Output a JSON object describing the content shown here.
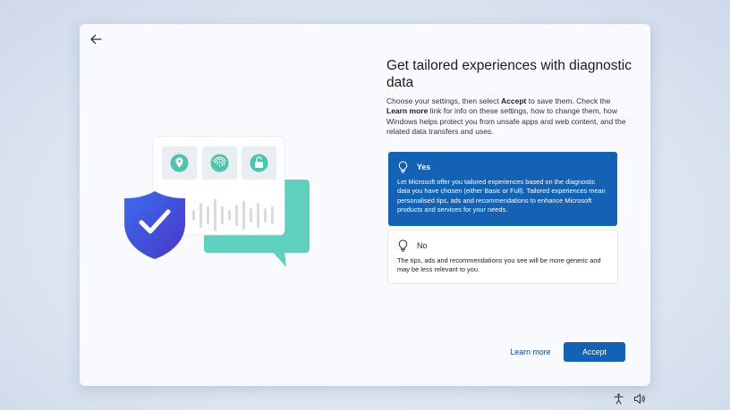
{
  "window": {
    "back_icon": "arrow-left-icon"
  },
  "heading": {
    "title": "Get tailored experiences with diagnostic data",
    "desc_1": "Choose your settings, then select ",
    "desc_accept": "Accept",
    "desc_2": " to save them. Check the ",
    "desc_learn": "Learn more",
    "desc_3": " link for info on these settings, how to change them, how Windows helps protect you from unsafe apps and web content, and the related data transfers and uses."
  },
  "options": [
    {
      "label": "Yes",
      "selected": true,
      "icon": "lightbulb-icon",
      "text": "Let Microsoft offer you tailored experiences based on the diagnostic data you have chosen (either Basic or Full). Tailored experiences mean personalised tips, ads and recommendations to enhance Microsoft products and services for your needs."
    },
    {
      "label": "No",
      "selected": false,
      "icon": "lightbulb-icon",
      "text": "The tips, ads and recommendations you see will be more generic and may be less relevant to you."
    }
  ],
  "footer": {
    "learn_more": "Learn more",
    "accept": "Accept"
  },
  "tray": [
    "accessibility-icon",
    "volume-icon"
  ],
  "colors": {
    "accent": "#1462b6",
    "teal": "#5fd0bd",
    "shield": "#3a4fd6"
  }
}
